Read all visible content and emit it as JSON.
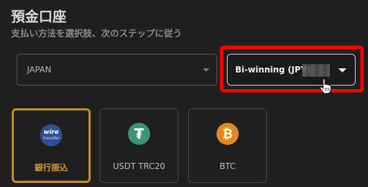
{
  "header": {
    "title": "預金口座",
    "subtitle": "支払い方法を選択肢、次のステップに従う"
  },
  "country_select": {
    "value": "JAPAN"
  },
  "account_select": {
    "value": "Bi-winning (JPY) -"
  },
  "payment_methods": [
    {
      "label": "銀行振込",
      "icon": "wire-transfer-icon",
      "icon_text_1": "wire",
      "icon_text_2": "transfer",
      "selected": true
    },
    {
      "label": "USDT TRC20",
      "icon": "tether-icon",
      "icon_text": "₮",
      "selected": false
    },
    {
      "label": "BTC",
      "icon": "bitcoin-icon",
      "icon_text": "₿",
      "selected": false
    }
  ],
  "colors": {
    "background": "#1f1f1f",
    "accent": "#c8902a",
    "highlight": "#ff0000",
    "tether": "#3a9478",
    "bitcoin": "#e38a1e",
    "wire": "#2e4f94"
  }
}
